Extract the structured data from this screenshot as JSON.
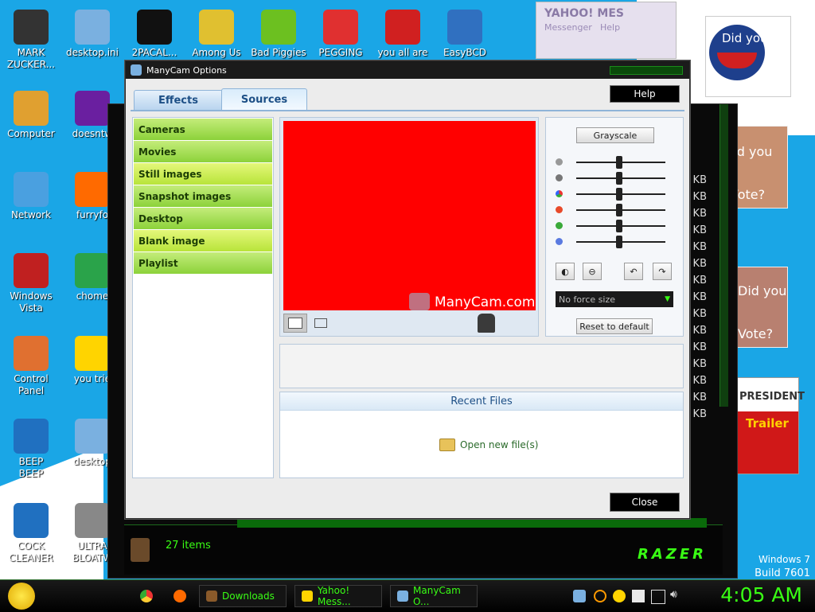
{
  "desktop": {
    "icons_left": [
      {
        "label": "MARK\nZUCKER...",
        "color": "#333"
      },
      {
        "label": "Computer",
        "color": "#e0a030"
      },
      {
        "label": "Network",
        "color": "#4aa0e0"
      },
      {
        "label": "Windows\nVista",
        "color": "#c02020"
      },
      {
        "label": "Control\nPanel",
        "color": "#e07030"
      },
      {
        "label": "BEEP\nBEEP",
        "color": "#2070c0"
      },
      {
        "label": "COCK\nCLEANER",
        "color": "#2070c0"
      }
    ],
    "icons_col2": [
      {
        "label": "desktop.ini",
        "color": "#7ab0e0"
      },
      {
        "label": "doesntw",
        "color": "#6a1fa0"
      },
      {
        "label": "furryfo",
        "color": "#ff6a00"
      },
      {
        "label": "chome",
        "color": "#2aa34a"
      },
      {
        "label": "you trie",
        "color": "#ffd400"
      },
      {
        "label": "desktop",
        "color": "#7ab0e0"
      },
      {
        "label": "ULTRA\nBLOATW",
        "color": "#888"
      }
    ],
    "icons_top": [
      {
        "label": "2PACAL...",
        "color": "#111"
      },
      {
        "label": "Among Us",
        "color": "#e0c030"
      },
      {
        "label": "Bad Piggies",
        "color": "#6cc020"
      },
      {
        "label": "PEGGING",
        "color": "#e03030"
      },
      {
        "label": "you all are",
        "color": "#d02020"
      },
      {
        "label": "EasyBCD",
        "color": "#3070c0"
      }
    ],
    "watermark": {
      "line1": "Windows 7",
      "line2": "Build 7601"
    },
    "posters": {
      "did_you_vote_1": "Did you",
      "did_you_vote_2": "Vote?",
      "president": "PRESIDENT",
      "trailer": "Trailer"
    }
  },
  "yahoo_window": {
    "title": "YAHOO! MES",
    "menu1": "Messenger",
    "menu2": "Help"
  },
  "explorer": {
    "item_count": "27 items",
    "size_unit": "KB",
    "brand": "RAZER"
  },
  "dialog": {
    "title": "ManyCam Options",
    "tabs": [
      {
        "label": "Effects"
      },
      {
        "label": "Sources"
      }
    ],
    "help_label": "Help",
    "close_label": "Close",
    "sources": [
      {
        "label": "Cameras",
        "alt": false
      },
      {
        "label": "Movies",
        "alt": false
      },
      {
        "label": "Still images",
        "alt": true
      },
      {
        "label": "Snapshot images",
        "alt": false
      },
      {
        "label": "Desktop",
        "alt": false
      },
      {
        "label": "Blank image",
        "alt": true
      },
      {
        "label": "Playlist",
        "alt": false
      }
    ],
    "preview_color": "#ff0000",
    "watermark": "ManyCam.com",
    "grayscale_label": "Grayscale",
    "force_size_value": "No force size",
    "reset_label": "Reset to default",
    "recent_files_title": "Recent Files",
    "open_file_label": "Open new file(s)"
  },
  "taskbar": {
    "buttons": [
      {
        "label": "Downloads"
      },
      {
        "label": "Yahoo! Mess..."
      },
      {
        "label": "ManyCam O..."
      }
    ],
    "clock": "4:05 AM"
  }
}
